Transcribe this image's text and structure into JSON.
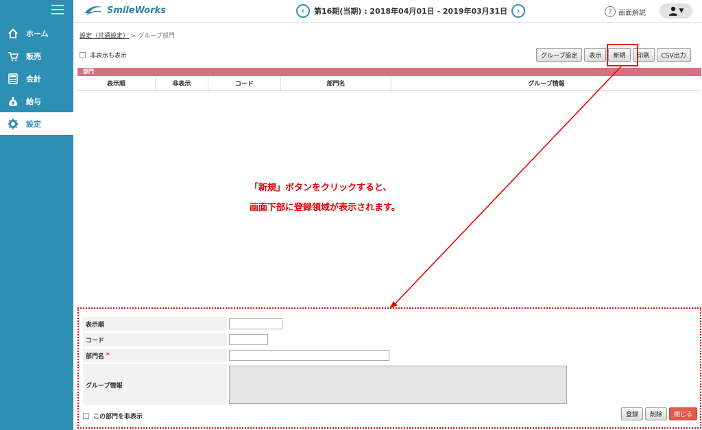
{
  "app": {
    "logo_text": "SmileWorks"
  },
  "header": {
    "period_label": "第16期(当期) : 2018年04月01日 - 2019年03月31日",
    "help_label": "画面解説"
  },
  "sidebar": {
    "items": [
      {
        "label": "ホーム",
        "icon": "home-icon"
      },
      {
        "label": "販売",
        "icon": "cart-icon"
      },
      {
        "label": "会計",
        "icon": "calculator-icon"
      },
      {
        "label": "給与",
        "icon": "money-bag-icon"
      },
      {
        "label": "設定",
        "icon": "gear-icon"
      }
    ],
    "active": "設定"
  },
  "breadcrumb": {
    "link": "設定（共通設定）",
    "separator": ">",
    "current": "グループ部門"
  },
  "filter": {
    "show_hidden_label": "非表示も表示"
  },
  "toolbar": {
    "group_setting": "グループ設定",
    "display": "表示",
    "new": "新規",
    "print": "印刷",
    "csv": "CSV出力"
  },
  "grid": {
    "title": "部門",
    "columns": [
      "表示順",
      "非表示",
      "コード",
      "部門名",
      "グループ情報"
    ]
  },
  "annotation": {
    "line1": "「新規」ボタンをクリックすると、",
    "line2": "画面下部に登録領域が表示されます。"
  },
  "form": {
    "order_label": "表示順",
    "code_label": "コード",
    "name_label": "部門名",
    "required_mark": "*",
    "group_label": "グループ情報",
    "hide_label": "この部門を非表示",
    "register": "登録",
    "delete": "削除",
    "close": "閉じる"
  },
  "colors": {
    "sidebar": "#2e8fb4",
    "grid_header": "#d4707f",
    "annotation": "#dd0000",
    "close_button": "#e25b4b"
  }
}
